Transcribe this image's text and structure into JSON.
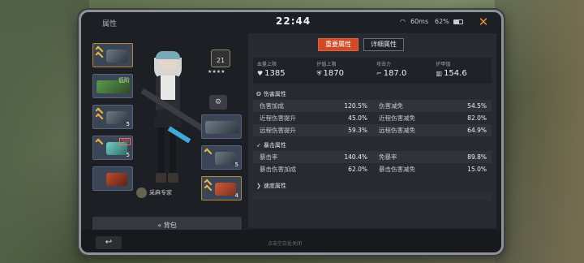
{
  "status_bar": {
    "title": "属性",
    "time": "22:44",
    "ping": "60ms",
    "battery": "62%",
    "close_icon": "close-icon"
  },
  "character": {
    "level": "21",
    "title": "采麻专家",
    "backpack_label": "背包",
    "gear_badge_red": "0/0",
    "gear_counts": [
      "5",
      "5",
      "4"
    ],
    "gear_tag_green": "低阶"
  },
  "tabs": [
    {
      "label": "重要属性",
      "active": true
    },
    {
      "label": "详细属性",
      "active": false
    }
  ],
  "main_stats": [
    {
      "label": "血量上限",
      "value": "1385",
      "icon": "heart-icon"
    },
    {
      "label": "护盾上限",
      "value": "1870",
      "icon": "shield-icon"
    },
    {
      "label": "攻击力",
      "value": "187.0",
      "icon": "gun-icon"
    },
    {
      "label": "护甲值",
      "value": "154.6",
      "icon": "armor-icon"
    }
  ],
  "sections": {
    "damage": {
      "title": "伤害属性",
      "rows": [
        [
          {
            "k": "伤害加成",
            "v": "120.5%"
          },
          {
            "k": "伤害减免",
            "v": "54.5%"
          }
        ],
        [
          {
            "k": "近程伤害提升",
            "v": "45.0%"
          },
          {
            "k": "近程伤害减免",
            "v": "82.0%"
          }
        ],
        [
          {
            "k": "远程伤害提升",
            "v": "59.3%"
          },
          {
            "k": "远程伤害减免",
            "v": "64.9%"
          }
        ]
      ]
    },
    "crit": {
      "title": "暴击属性",
      "rows": [
        [
          {
            "k": "暴击率",
            "v": "140.4%"
          },
          {
            "k": "免暴率",
            "v": "89.8%"
          }
        ],
        [
          {
            "k": "暴击伤害加成",
            "v": "62.0%"
          },
          {
            "k": "暴击伤害减免",
            "v": "15.0%"
          }
        ]
      ]
    },
    "speed": {
      "title": "速度属性"
    }
  },
  "bottom": {
    "hint": "点击空白处关闭"
  },
  "colors": {
    "accent": "#d04a28",
    "panel": "#272b31",
    "rank_gold": "#f0b640"
  }
}
